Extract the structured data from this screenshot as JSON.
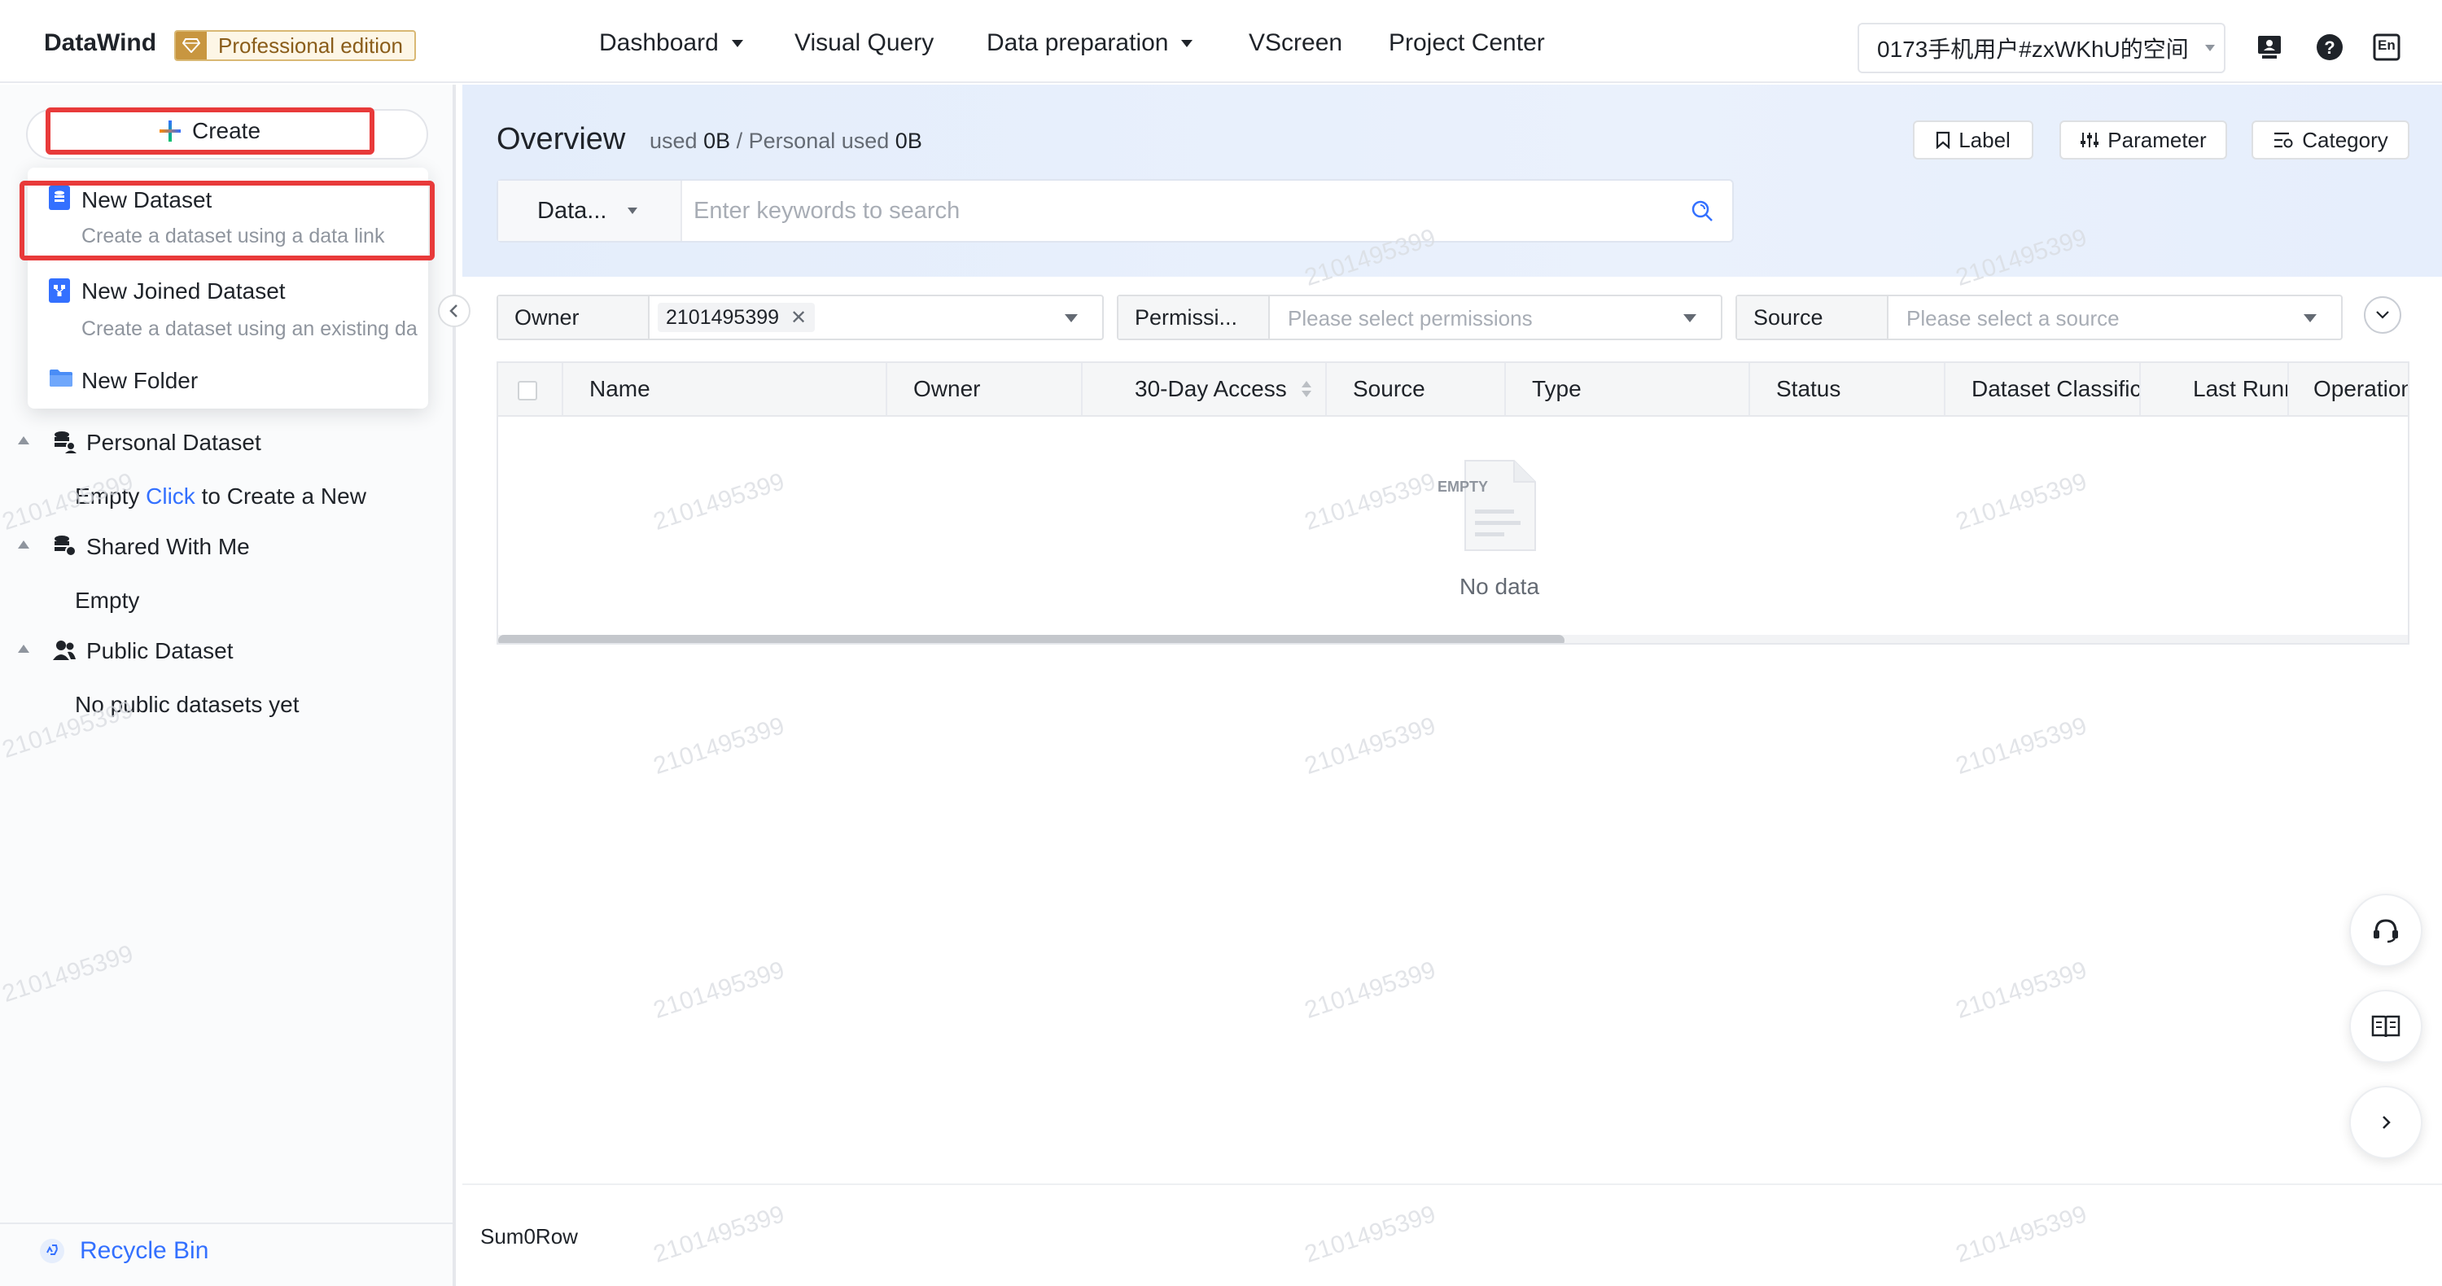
{
  "header": {
    "brand": "DataWind",
    "edition": "Professional edition",
    "nav": [
      {
        "label": "Dashboard",
        "has_dropdown": true
      },
      {
        "label": "Visual Query",
        "has_dropdown": false
      },
      {
        "label": "Data preparation",
        "has_dropdown": true
      },
      {
        "label": "VScreen",
        "has_dropdown": false
      },
      {
        "label": "Project Center",
        "has_dropdown": false
      }
    ],
    "workspace": "0173手机用户#zxWKhU的空间",
    "icons": [
      "screen-icon",
      "help-icon",
      "language-icon"
    ],
    "language_icon_text": "En"
  },
  "sidebar": {
    "create_label": "Create",
    "create_menu": [
      {
        "title": "New Dataset",
        "desc": "Create a dataset using a data link",
        "icon": "dataset-icon"
      },
      {
        "title": "New Joined Dataset",
        "desc": "Create a dataset using an existing da",
        "icon": "joined-dataset-icon"
      },
      {
        "title": "New Folder",
        "desc": "",
        "icon": "folder-icon"
      }
    ],
    "tree": [
      {
        "label": "Personal Dataset",
        "icon": "personal-dataset-icon"
      },
      {
        "label": "Shared With Me",
        "icon": "shared-dataset-icon"
      },
      {
        "label": "Public Dataset",
        "icon": "public-dataset-icon"
      }
    ],
    "personal_empty_prefix": "Empty",
    "personal_empty_link": "Click",
    "personal_empty_suffix": "to Create a New",
    "shared_empty": "Empty",
    "public_empty": "No public datasets yet",
    "recycle_bin": "Recycle Bin"
  },
  "overview": {
    "title": "Overview",
    "used_label": "used",
    "used_value": "0B",
    "separator": "/",
    "personal_used_label": "Personal used",
    "personal_used_value": "0B",
    "buttons": {
      "label": "Label",
      "parameter": "Parameter",
      "category": "Category"
    },
    "search_type": "Data...",
    "search_placeholder": "Enter keywords to search"
  },
  "filters": {
    "owner_label": "Owner",
    "owner_value": "2101495399",
    "permission_label": "Permissi...",
    "permission_placeholder": "Please select permissions",
    "source_label": "Source",
    "source_placeholder": "Please select a source"
  },
  "table": {
    "columns": [
      "Name",
      "Owner",
      "30-Day Access",
      "Source",
      "Type",
      "Status",
      "Dataset Classifica",
      "Last Runr",
      "Operation"
    ],
    "empty_icon_text": "EMPTY",
    "empty_text": "No data"
  },
  "footer": {
    "sum": "Sum0Row"
  },
  "watermark": "2101495399",
  "colors": {
    "accent": "#3370ff",
    "highlight": "#e83a3a",
    "edition": "#c89640"
  }
}
